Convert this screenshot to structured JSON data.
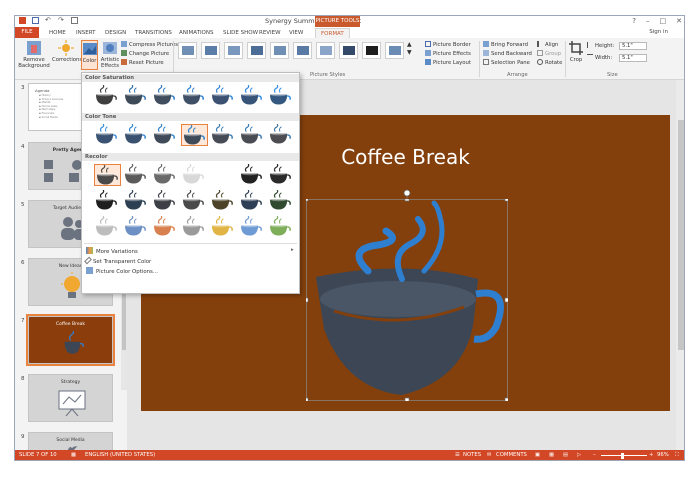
{
  "window": {
    "title": "Synergy Summit - PowerPoint",
    "context_tab": "PICTURE TOOLS",
    "controls": [
      "?",
      "–",
      "□",
      "✕"
    ],
    "sign_in": "Sign in"
  },
  "tabs": [
    "FILE",
    "HOME",
    "INSERT",
    "DESIGN",
    "TRANSITIONS",
    "ANIMATIONS",
    "SLIDE SHOW",
    "REVIEW",
    "VIEW",
    "FORMAT"
  ],
  "ribbon": {
    "remove_background": "Remove Background",
    "corrections": "Corrections",
    "color": "Color",
    "artistic_effects": "Artistic Effects",
    "compress_pictures": "Compress Pictures",
    "change_picture": "Change Picture",
    "reset_picture": "Reset Picture",
    "picture_border": "Picture Border",
    "picture_effects": "Picture Effects",
    "picture_layout": "Picture Layout",
    "bring_forward": "Bring Forward",
    "send_backward": "Send Backward",
    "selection_pane": "Selection Pane",
    "align": "Align",
    "group": "Group",
    "rotate": "Rotate",
    "crop": "Crop",
    "height_label": "Height:",
    "height_value": "5.1\"",
    "width_label": "Width:",
    "width_value": "5.1\"",
    "groups": {
      "picture_styles": "Picture Styles",
      "arrange": "Arrange",
      "size": "Size"
    }
  },
  "gallery": {
    "sections": {
      "saturation": "Color Saturation",
      "tone": "Color Tone",
      "recolor": "Recolor"
    },
    "menu": {
      "more_variations": "More Variations",
      "set_transparent": "Set Transparent Color",
      "options": "Picture Color Options..."
    },
    "saturation_colors": [
      [
        "#3f3f3f",
        "#3f3f3f"
      ],
      [
        "#3f4a58",
        "#2f6fb0"
      ],
      [
        "#3f4d5f",
        "#2f78c4"
      ],
      [
        "#3f5066",
        "#2f7fd0"
      ],
      [
        "#3b5272",
        "#2f84d8"
      ],
      [
        "#385579",
        "#2f88df"
      ],
      [
        "#34587f",
        "#2f8de6"
      ]
    ],
    "tone_colors": [
      [
        "#3a5372",
        "#3a8ad6"
      ],
      [
        "#3a5170",
        "#3586cf"
      ],
      [
        "#404b5a",
        "#3381c8"
      ],
      [
        "#404b5a",
        "#3381c8"
      ],
      [
        "#474b56",
        "#3a7cb8"
      ],
      [
        "#4a4c54",
        "#3c7ab0"
      ],
      [
        "#4c4c52",
        "#3f78a8"
      ]
    ],
    "recolor_rows": [
      [
        [
          "#4a4a4a",
          "#4a4a4a"
        ],
        [
          "#5a5a5a",
          "#5a5a5a"
        ],
        [
          "#6a6a6a",
          "#6a6a6a"
        ],
        [
          "#d8d8d8",
          "#d8d8d8"
        ],
        null,
        [
          "#222222",
          "#222222"
        ],
        [
          "#2a2a2a",
          "#2a2a2a"
        ]
      ],
      [
        [
          "#1f1f1f",
          "#1f1f1f"
        ],
        [
          "#2d3f52",
          "#2d3f52"
        ],
        [
          "#3c3f45",
          "#3c3f45"
        ],
        [
          "#4a4a4a",
          "#4a4a4a"
        ],
        [
          "#4c4328",
          "#4c4328"
        ],
        [
          "#2f3f55",
          "#2f3f55"
        ],
        [
          "#2f4a2f",
          "#2f4a2f"
        ]
      ],
      [
        [
          "#bdbdbd",
          "#bdbdbd"
        ],
        [
          "#6c90c4",
          "#6c90c4"
        ],
        [
          "#d9814e",
          "#d9814e"
        ],
        [
          "#9a9a9a",
          "#9a9a9a"
        ],
        [
          "#e0b445",
          "#e0b445"
        ],
        [
          "#6f9bd4",
          "#6f9bd4"
        ],
        [
          "#7fae5a",
          "#7fae5a"
        ]
      ]
    ]
  },
  "thumbnails": [
    {
      "num": "3",
      "title": "Agenda",
      "lines": [
        "History",
        "Today's business",
        "Market",
        "Online sales",
        "Next steps",
        "Financials",
        "Social Media"
      ]
    },
    {
      "num": "4",
      "title": "Pretty Agen..."
    },
    {
      "num": "5",
      "title": "Target Audien..."
    },
    {
      "num": "6",
      "title": "New Ideas"
    },
    {
      "num": "7",
      "title": "Coffee Break"
    },
    {
      "num": "8",
      "title": "Strategy"
    },
    {
      "num": "9",
      "title": "Social Media"
    }
  ],
  "slide": {
    "title": "Coffee Break",
    "background": "#84400c",
    "cup_color": "#3c4654",
    "steam_color": "#2f7fd0"
  },
  "statusbar": {
    "slide_info": "SLIDE 7 OF 10",
    "language": "ENGLISH (UNITED STATES)",
    "notes": "NOTES",
    "comments": "COMMENTS",
    "zoom": "96%"
  },
  "colors": {
    "accent": "#d24726",
    "format_tab": "#c85a2e",
    "selection": "#e8823e"
  }
}
